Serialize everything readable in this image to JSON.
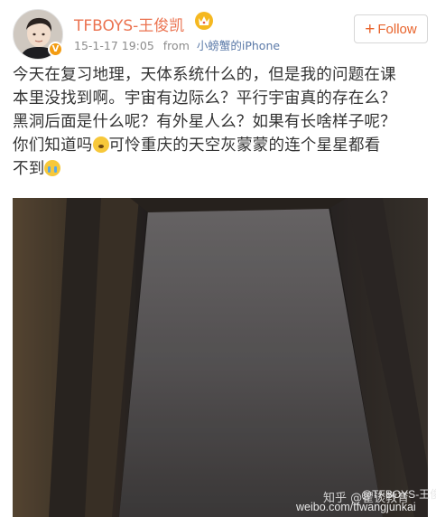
{
  "header": {
    "username": "TFBOYS-王俊凯",
    "timestamp": "15-1-17 19:05",
    "from_label": "from",
    "source": "小螃蟹的iPhone",
    "follow_plus": "+",
    "follow_label": "Follow",
    "verified_badge": "V",
    "verified_color": "#f39c12",
    "name_color": "#eb7350"
  },
  "post": {
    "lines": [
      "今天在复习地理，天体系统什么的，但是我的问题在课",
      "本里没找到啊。宇宙有边际么？平行宇宙真的存在么？",
      "黑洞后面是什么呢？有外星人么？如果有长啥样子呢？"
    ],
    "line4_before": "你们知道吗",
    "line4_after": "可怜重庆的天空灰蒙蒙的连个星星都看",
    "line5": "不到",
    "emoji_1": "thinking-emoji",
    "emoji_2": "crying-emoji"
  },
  "photo": {
    "watermark_weibo": "@TFBOYS-王俊凯",
    "watermark_zhihu": "知乎 @翟谈教育",
    "watermark_url": "weibo.com/tfwangjunkai"
  }
}
